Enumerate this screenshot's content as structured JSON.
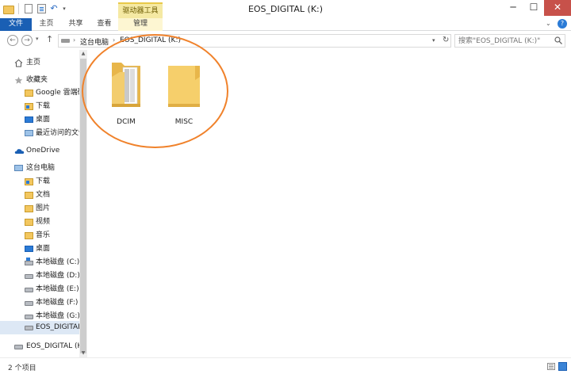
{
  "window": {
    "title": "EOS_DIGITAL (K:)",
    "context_tab": "驱动器工具",
    "minimize": "─",
    "maximize": "☐",
    "close": "✕"
  },
  "ribbon": {
    "tabs": [
      "文件",
      "主页",
      "共享",
      "查看",
      "管理"
    ]
  },
  "address": {
    "crumbs": [
      "这台电脑",
      "EOS_DIGITAL (K:)"
    ]
  },
  "search": {
    "placeholder": "搜索\"EOS_DIGITAL (K:)\""
  },
  "navpane": {
    "items": [
      {
        "label": "主页",
        "icon": "home-icon"
      },
      {
        "label": "收藏夹",
        "icon": "star-icon"
      },
      {
        "label": "Google 雲端硬",
        "icon": "folder-icon"
      },
      {
        "label": "下载",
        "icon": "downloads-icon"
      },
      {
        "label": "桌面",
        "icon": "desktop-icon"
      },
      {
        "label": "最近访问的文件",
        "icon": "recent-icon"
      },
      {
        "label": "OneDrive",
        "icon": "onedrive-icon"
      },
      {
        "label": "这台电脑",
        "icon": "pc-icon"
      },
      {
        "label": "下载",
        "icon": "downloads-icon"
      },
      {
        "label": "文档",
        "icon": "documents-icon"
      },
      {
        "label": "图片",
        "icon": "pictures-icon"
      },
      {
        "label": "视频",
        "icon": "videos-icon"
      },
      {
        "label": "音乐",
        "icon": "music-icon"
      },
      {
        "label": "桌面",
        "icon": "desktop-icon"
      },
      {
        "label": "本地磁盘 (C:)",
        "icon": "system-drive-icon"
      },
      {
        "label": "本地磁盘 (D:)",
        "icon": "drive-icon"
      },
      {
        "label": "本地磁盘 (E:)",
        "icon": "drive-icon"
      },
      {
        "label": "本地磁盘 (F:)",
        "icon": "drive-icon"
      },
      {
        "label": "本地磁盘 (G:)",
        "icon": "drive-icon"
      },
      {
        "label": "EOS_DIGITAL",
        "icon": "removable-drive-icon"
      },
      {
        "label": "EOS_DIGITAL (K:",
        "icon": "removable-drive-icon"
      }
    ]
  },
  "content": {
    "items": [
      {
        "name": "DCIM",
        "icon": "folder-with-files-icon"
      },
      {
        "name": "MISC",
        "icon": "empty-folder-icon"
      }
    ]
  },
  "status": {
    "count": "2 个项目"
  },
  "colors": {
    "accent": "#1a5fb4",
    "context_tab": "#f5e9a3",
    "annotation": "#f0822b",
    "close": "#c7514a",
    "folder": "#f3c75f"
  }
}
